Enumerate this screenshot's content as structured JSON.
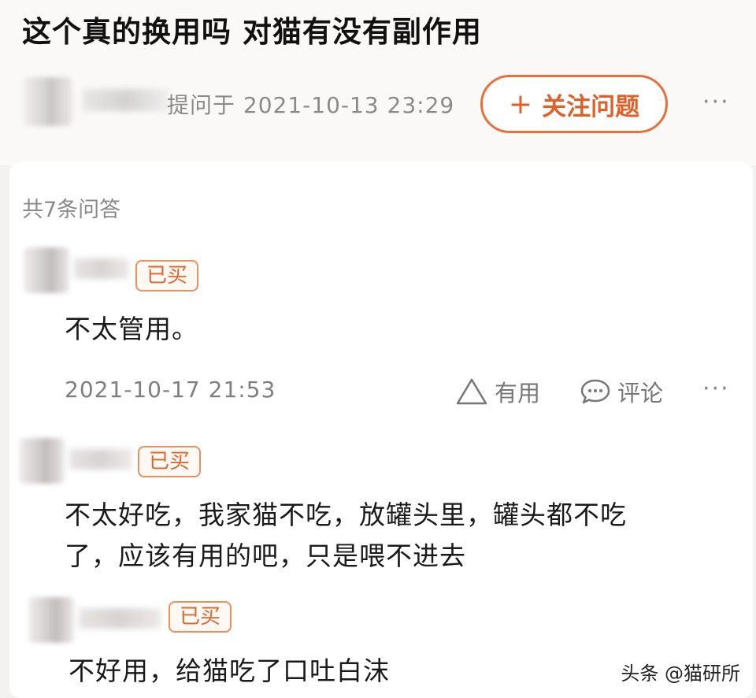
{
  "question": {
    "title": "这个真的换用吗 对猫有没有副作用",
    "asked_at": "提问于 2021-10-13 23:29",
    "follow_label": "关注问题",
    "follow_icon": "plus-icon",
    "more_label": "···"
  },
  "answers": {
    "count_label": "共7条问答",
    "items": [
      {
        "badge": "已买",
        "text": "不太管用。",
        "date": "2021-10-17 21:53",
        "useful_label": "有用",
        "comment_label": "评论",
        "more_label": "···"
      },
      {
        "badge": "已买",
        "text_line1": "不太好吃，我家猫不吃，放罐头里，罐头都不吃",
        "text_line2": "了，应该有用的吧，只是喂不进去"
      },
      {
        "badge": "已买",
        "text": "不好用，给猫吃了口吐白沫"
      }
    ]
  },
  "watermark": "头条 @猫研所",
  "colors": {
    "accent": "#e8703c",
    "badge_border": "#e9915f",
    "muted_text": "#8a8a8a"
  }
}
